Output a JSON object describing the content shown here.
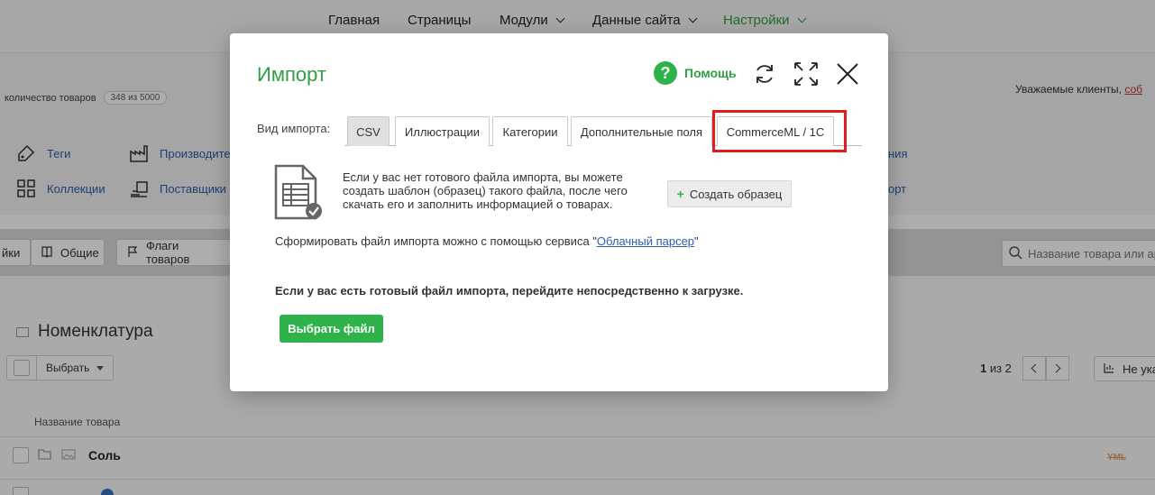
{
  "topnav": {
    "items": [
      {
        "label": "Главная",
        "dropdown": false
      },
      {
        "label": "Страницы",
        "dropdown": false
      },
      {
        "label": "Модули",
        "dropdown": true
      },
      {
        "label": "Данные сайта",
        "dropdown": true
      },
      {
        "label": "Настройки",
        "dropdown": true,
        "active": true
      }
    ]
  },
  "background": {
    "count_label": "количество товаров",
    "count_badge": "348 из 5000",
    "notice_text": "Уважаемые клиенты, ",
    "notice_link": "соб",
    "quick_links": [
      "Теги",
      "Производите",
      "Коллекции",
      "Поставщики",
      "ния",
      "орт"
    ],
    "toolbar": {
      "left_cut": "йки",
      "general": "Общие",
      "flags": "Флаги товаров"
    },
    "search_placeholder": "Название товара или ар",
    "section_title": "Номенклатура",
    "select_label": "Выбрать",
    "pager": {
      "current": "1",
      "total_text": " из 2"
    },
    "not_shown": "Не ука",
    "column_header": "Название товара",
    "rows": [
      {
        "name": "Соль",
        "badge": "YML"
      }
    ]
  },
  "modal": {
    "title": "Импорт",
    "help_label": "Помощь",
    "icons": [
      "refresh-icon",
      "fullscreen-icon",
      "close-icon"
    ],
    "tabs_label": "Вид импорта:",
    "tabs": [
      {
        "label": "CSV",
        "active": true
      },
      {
        "label": "Иллюстрации",
        "active": false
      },
      {
        "label": "Категории",
        "active": false
      },
      {
        "label": "Дополнительные поля",
        "active": false
      },
      {
        "label": "CommerceML / 1C",
        "active": false,
        "highlighted": true
      }
    ],
    "info_text": "Если у вас нет готового файла импорта, вы можете создать шаблон (образец) такого файла, после чего скачать его и заполнить информацией о товарах.",
    "create_sample_label": "Создать образец",
    "parser_prefix": "Сформировать файл импорта можно с помощью сервиса \"",
    "parser_link": "Облачный парсер",
    "parser_suffix": "\"",
    "ready_text": "Если у вас есть готовый файл импорта, перейдите непосредственно к загрузке.",
    "choose_file_label": "Выбрать файл"
  },
  "colors": {
    "accent_green": "#2f9e44",
    "button_green": "#2db34a",
    "highlight_red": "#e21c1c",
    "link_blue": "#2a5ea8"
  }
}
